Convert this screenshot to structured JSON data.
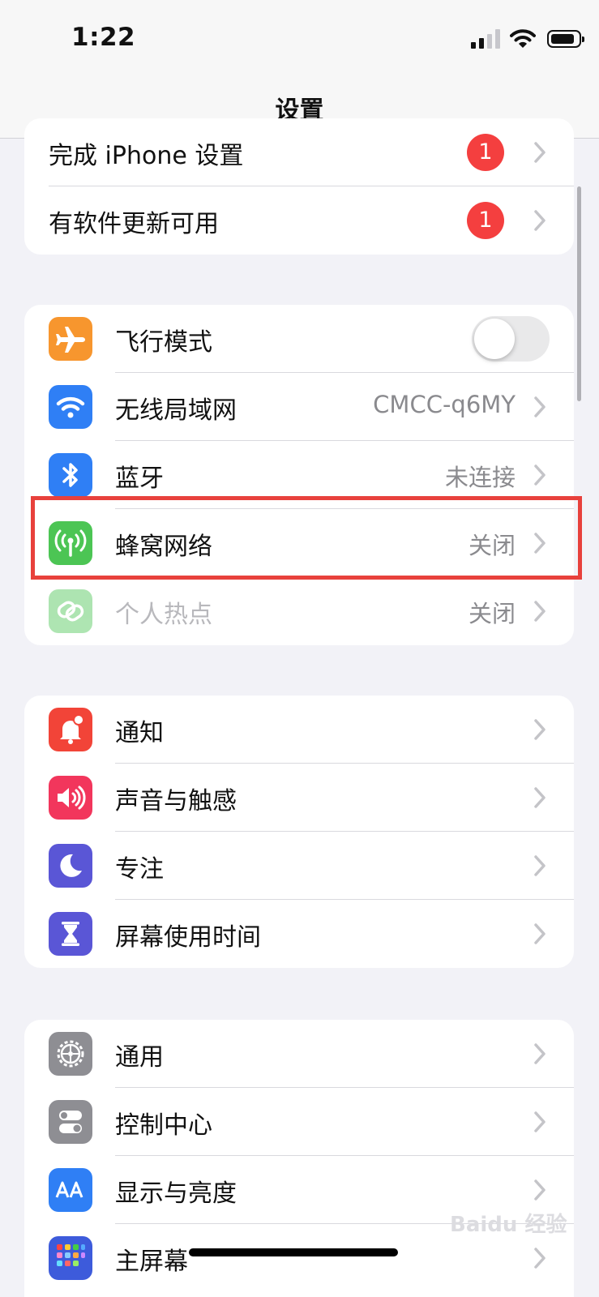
{
  "status_bar": {
    "time": "1:22"
  },
  "nav": {
    "title": "设置"
  },
  "group_top": {
    "items": [
      {
        "label": "完成 iPhone 设置",
        "badge": "1"
      },
      {
        "label": "有软件更新可用",
        "badge": "1"
      }
    ]
  },
  "group_network": {
    "items": [
      {
        "label": "飞行模式",
        "icon": "airplane-icon",
        "icon_color": "#f7962e",
        "toggle": "off"
      },
      {
        "label": "无线局域网",
        "icon": "wifi-icon",
        "icon_color": "#2f7ff5",
        "value": "CMCC-q6MY"
      },
      {
        "label": "蓝牙",
        "icon": "bluetooth-icon",
        "icon_color": "#2f7ff5",
        "value": "未连接"
      },
      {
        "label": "蜂窝网络",
        "icon": "cellular-antenna-icon",
        "icon_color": "#4cc554",
        "value": "关闭",
        "highlighted": true
      },
      {
        "label": "个人热点",
        "icon": "hotspot-chain-icon",
        "icon_color": "#4cc554",
        "value": "关闭",
        "dimmed": true
      }
    ]
  },
  "group_notifications": {
    "items": [
      {
        "label": "通知",
        "icon": "notification-bell-icon",
        "icon_color": "#f24438"
      },
      {
        "label": "声音与触感",
        "icon": "speaker-icon",
        "icon_color": "#f2365c"
      },
      {
        "label": "专注",
        "icon": "moon-icon",
        "icon_color": "#5a56d6"
      },
      {
        "label": "屏幕使用时间",
        "icon": "hourglass-icon",
        "icon_color": "#5a56d6"
      }
    ]
  },
  "group_general": {
    "items": [
      {
        "label": "通用",
        "icon": "gear-icon",
        "icon_color": "#8e8e93"
      },
      {
        "label": "控制中心",
        "icon": "toggles-icon",
        "icon_color": "#8e8e93"
      },
      {
        "label": "显示与亮度",
        "icon": "text-size-icon",
        "icon_color": "#2f7ff5"
      },
      {
        "label": "主屏幕",
        "icon": "home-screen-grid-icon",
        "icon_color": "#3d5bdb"
      }
    ]
  },
  "watermark": {
    "text": "Baidu 经验"
  }
}
